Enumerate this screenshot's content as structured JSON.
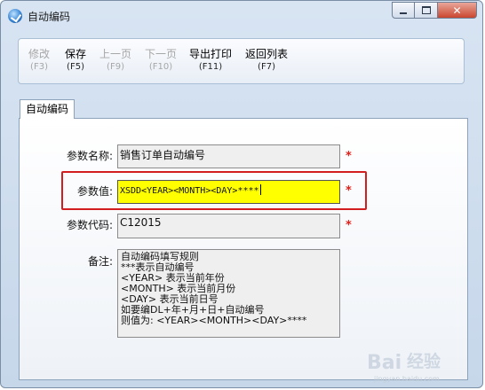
{
  "window": {
    "title": "自动编码"
  },
  "toolbar": {
    "buttons": [
      {
        "label": "修改",
        "key": "(F3)"
      },
      {
        "label": "保存",
        "key": "(F5)"
      },
      {
        "label": "上一页",
        "key": "(F9)"
      },
      {
        "label": "下一页",
        "key": "(F10)"
      },
      {
        "label": "导出打印",
        "key": "(F11)"
      },
      {
        "label": "返回列表",
        "key": "(F7)"
      }
    ]
  },
  "tab": {
    "label": "自动编码"
  },
  "form": {
    "param_name": {
      "label": "参数名称:",
      "value": "销售订单自动编号"
    },
    "param_value": {
      "label": "参数值:",
      "value": "XSDD<YEAR><MONTH><DAY>****"
    },
    "param_code": {
      "label": "参数代码:",
      "value": "C12015"
    },
    "remarks": {
      "label": "备注:",
      "value": "自动编码填写规则\n***表示自动编号\n<YEAR> 表示当前年份\n<MONTH> 表示当前月份\n<DAY> 表示当前日号\n如要编DL+年+月+日+自动编号\n则值为: <YEAR><MONTH><DAY>****"
    },
    "required_mark": "*"
  },
  "watermark": {
    "logo": "Bai",
    "logo2": "经验",
    "url": "jingyan.baidu.com"
  },
  "colors": {
    "highlight": "#d21e1e",
    "active_field": "#ffff00",
    "required": "#e0201a"
  }
}
